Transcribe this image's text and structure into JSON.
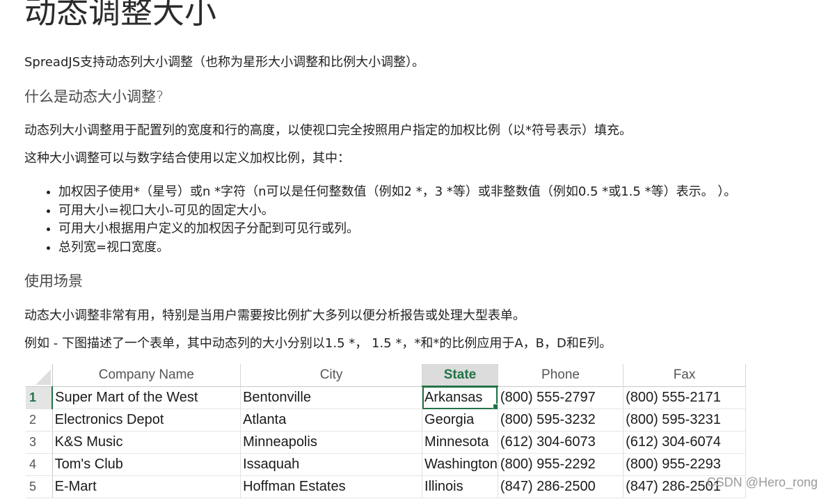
{
  "title": "动态调整大小",
  "intro": "SpreadJS支持动态列大小调整（也称为星形大小调整和比例大小调整）。",
  "section1_heading": "什么是动态大小调整?",
  "section1_p1": "动态列大小调整用于配置列的宽度和行的高度，以使视口完全按照用户指定的加权比例（以*符号表示）填充。",
  "section1_p2": "这种大小调整可以与数字结合使用以定义加权比例，其中：",
  "bullets": [
    "加权因子使用*（星号）或n *字符（n可以是任何整数值（例如2 *，3 *等）或非整数值（例如0.5 *或1.5 *等）表示。 ）。",
    "可用大小=视口大小-可见的固定大小。",
    "可用大小根据用户定义的加权因子分配到可见行或列。",
    "总列宽=视口宽度。"
  ],
  "section2_heading": "使用场景",
  "section2_p1": "动态大小调整非常有用，特别是当用户需要按比例扩大多列以便分析报告或处理大型表单。",
  "section2_p2": "例如 - 下图描述了一个表单，其中动态列的大小分别以1.5 *， 1.5 *，*和*的比例应用于A，B，D和E列。",
  "sheet": {
    "headers": [
      "Company Name",
      "City",
      "State",
      "Phone",
      "Fax"
    ],
    "active_column": "State",
    "rows": [
      {
        "num": "1",
        "cells": [
          "Super Mart of the West",
          "Bentonville",
          "Arkansas",
          "(800) 555-2797",
          "(800) 555-2171"
        ]
      },
      {
        "num": "2",
        "cells": [
          "Electronics Depot",
          "Atlanta",
          "Georgia",
          "(800) 595-3232",
          "(800) 595-3231"
        ]
      },
      {
        "num": "3",
        "cells": [
          "K&S Music",
          "Minneapolis",
          "Minnesota",
          "(612) 304-6073",
          "(612) 304-6074"
        ]
      },
      {
        "num": "4",
        "cells": [
          "Tom's Club",
          "Issaquah",
          "Washington",
          "(800) 955-2292",
          "(800) 955-2293"
        ]
      },
      {
        "num": "5",
        "cells": [
          "E-Mart",
          "Hoffman Estates",
          "Illinois",
          "(847) 286-2500",
          "(847) 286-2501"
        ]
      }
    ],
    "accent_color": "#217346"
  },
  "watermark": "CSDN @Hero_rong"
}
